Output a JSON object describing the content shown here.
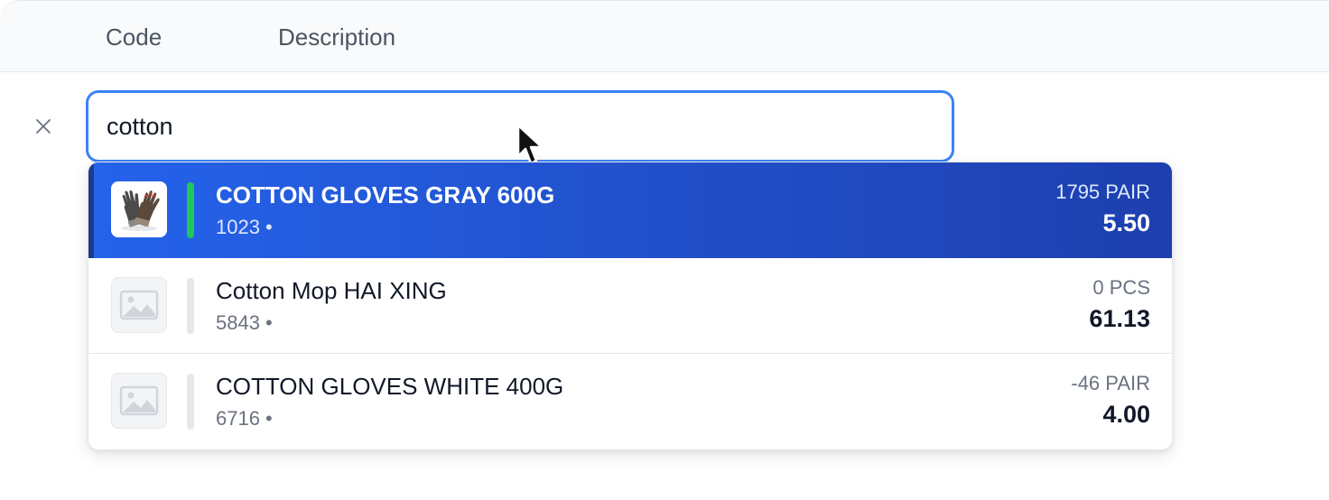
{
  "header": {
    "columns": [
      "Code",
      "Description"
    ]
  },
  "search": {
    "value": "cotton",
    "clear_icon": "close-icon"
  },
  "colors": {
    "accent": "#3b82f6",
    "selected_row": "#2563eb",
    "in_stock": "#22c55e",
    "no_stock": "#e5e7eb"
  },
  "results": [
    {
      "name": "COTTON GLOVES GRAY 600G",
      "code": "1023 •",
      "qty": "1795 PAIR",
      "price": "5.50",
      "image": "gloves-image",
      "in_stock": true,
      "selected": true
    },
    {
      "name": "Cotton Mop HAI XING",
      "code": "5843 •",
      "qty": "0 PCS",
      "price": "61.13",
      "image": "image-placeholder-icon",
      "in_stock": false,
      "selected": false
    },
    {
      "name": "COTTON GLOVES WHITE 400G",
      "code": "6716 •",
      "qty": "-46 PAIR",
      "price": "4.00",
      "image": "image-placeholder-icon",
      "in_stock": false,
      "selected": false
    }
  ]
}
